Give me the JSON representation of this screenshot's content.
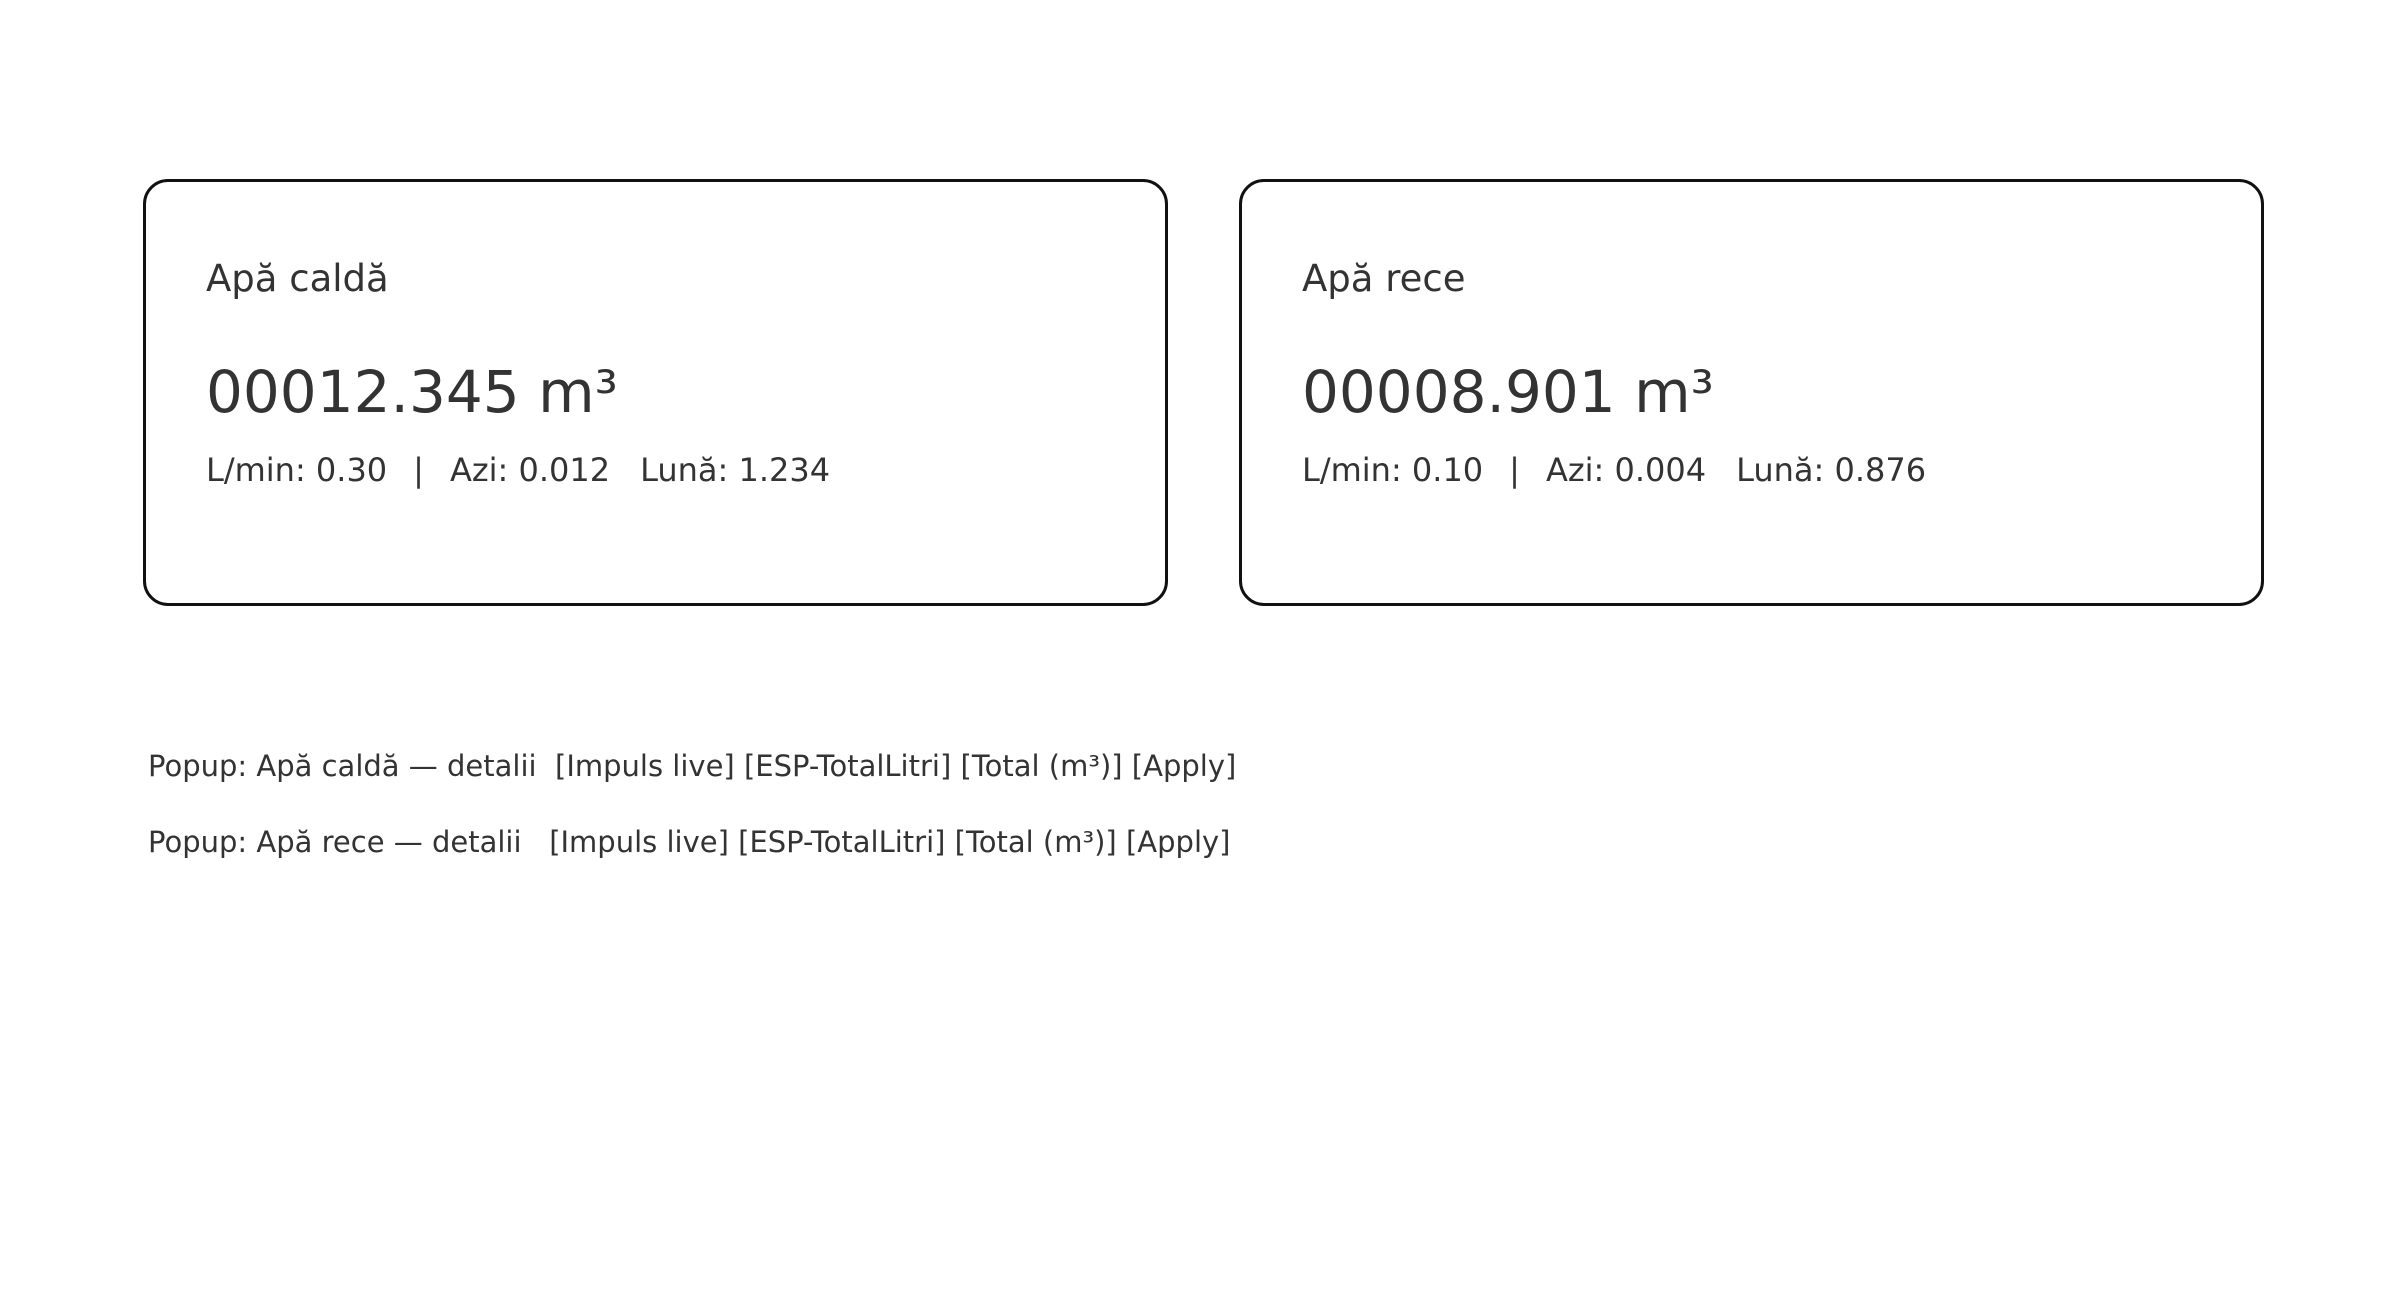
{
  "cards": [
    {
      "title": "Apă caldă",
      "total": "00012.345 m³",
      "flow": "L/min: 0.30",
      "separator": "|",
      "today": "Azi: 0.012",
      "month": "Lună: 1.234"
    },
    {
      "title": "Apă rece",
      "total": "00008.901 m³",
      "flow": "L/min: 0.10",
      "separator": "|",
      "today": "Azi: 0.004",
      "month": "Lună: 0.876"
    }
  ],
  "popups": [
    {
      "label": "Popup: Apă caldă — detalii",
      "buttons": [
        "[Impuls live]",
        "[ESP-TotalLitri]",
        "[Total (m³)]",
        "[Apply]"
      ]
    },
    {
      "label": "Popup: Apă rece — detalii",
      "buttons": [
        "[Impuls live]",
        "[ESP-TotalLitri]",
        "[Total (m³)]",
        "[Apply]"
      ]
    }
  ]
}
